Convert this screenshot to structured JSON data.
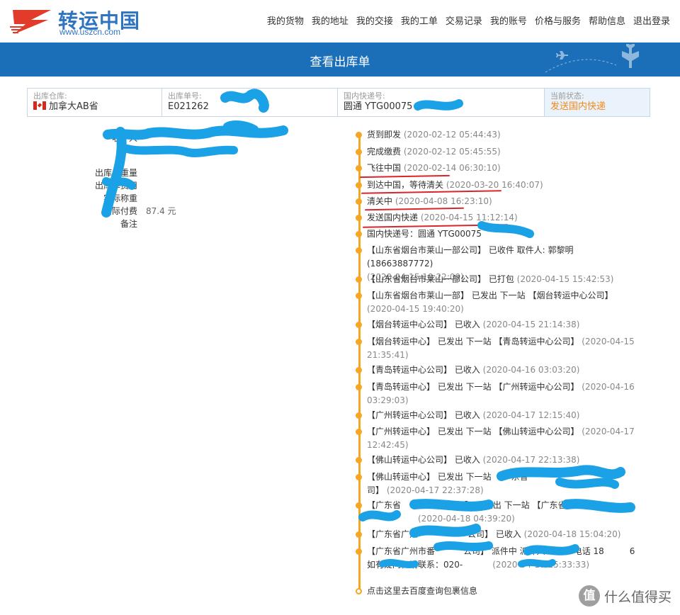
{
  "header": {
    "logo_cn": "转运中国",
    "logo_url": "www.uszcn.com",
    "nav": [
      "我的货物",
      "我的地址",
      "我的交接",
      "我的工单",
      "交易记录",
      "我的账号",
      "价格与服务",
      "帮助信息",
      "退出登录"
    ]
  },
  "banner": {
    "title": "查看出库单"
  },
  "info": {
    "warehouse_label": "出库仓库:",
    "warehouse_value": "加拿大AB省",
    "order_label": "出库单号:",
    "order_value": "E021262",
    "express_label": "国内快递号:",
    "express_value": "圆通 YTG00075",
    "status_label": "当前状态:",
    "status_value": "发送国内快递"
  },
  "details": {
    "receiver_label": "收件人",
    "weight_label": "出库单重量",
    "fee_label": "出库单费用",
    "actual_weight_label": "实际称重",
    "actual_fee_label": "实际付费",
    "actual_fee_value": "87.4 元",
    "remark_label": "备注"
  },
  "timeline": [
    {
      "text": "货到即发",
      "time": "(2020-02-12 05:44:43)"
    },
    {
      "text": "完成缴费",
      "time": "(2020-02-12 05:45:55)"
    },
    {
      "text": "飞往中国",
      "time": "(2020-02-14 06:30:10)"
    },
    {
      "text": "到达中国，等待清关",
      "time": "(2020-03-20 16:40:07)"
    },
    {
      "text": "清关中",
      "time": "(2020-04-08 16:23:10)"
    },
    {
      "text": "发送国内快递",
      "time": "(2020-04-15 11:12:14)"
    },
    {
      "text": "国内快递号：圆通 YTG00075",
      "time": ""
    },
    {
      "text": "【山东省烟台市莱山一部公司】 已收件 取件人: 郭黎明 (18663887772)",
      "time": "(2020-04-15 10:22:09)"
    },
    {
      "text": "【山东省烟台市莱山一部公司】 已打包",
      "time": "(2020-04-15 15:42:53)"
    },
    {
      "text": "【山东省烟台市莱山一部】 已发出 下一站 【烟台转运中心公司】",
      "time": "(2020-04-15 19:40:20)"
    },
    {
      "text": "【烟台转运中心公司】 已收入",
      "time": "(2020-04-15 21:14:38)"
    },
    {
      "text": "【烟台转运中心】 已发出 下一站 【青岛转运中心公司】",
      "time": "(2020-04-15 21:35:41)"
    },
    {
      "text": "【青岛转运中心公司】 已收入",
      "time": "(2020-04-16 03:03:20)"
    },
    {
      "text": "【青岛转运中心】 已发出 下一站 【广州转运中心公司】",
      "time": "(2020-04-16 03:29:03)"
    },
    {
      "text": "【广州转运中心公司】 已收入",
      "time": "(2020-04-17 12:15:40)"
    },
    {
      "text": "【广州转运中心】 已发出 下一站 【佛山转运中心公司】",
      "time": "(2020-04-17 12:42:45)"
    },
    {
      "text": "【佛山转运中心公司】 已收入",
      "time": "(2020-04-17 22:13:38)"
    },
    {
      "text": "【佛山转运中心】 已发出 下一站 【广东省",
      "tail": "司】",
      "time": "(2020-04-17 22:37:28)"
    },
    {
      "text": "【广东省",
      "mid": "】 已发出 下一站 【广东省",
      "time": "(2020-04-18 04:39:20)"
    },
    {
      "text": "【广东省广州",
      "mid": "公司】 已收入",
      "time": "(2020-04-18 15:04:20)"
    },
    {
      "text": "【广东省广州市番",
      "mid": "公司】 派件中 派件人:",
      "tail2": "电话 18",
      "tail3": "6 如有疑问，请联系：020-",
      "time": "(2020-04-18 15:33:33)"
    }
  ],
  "last_link": "点击这里去百度查询包裹信息",
  "watermark": {
    "badge": "值",
    "text": "什么值得买"
  }
}
